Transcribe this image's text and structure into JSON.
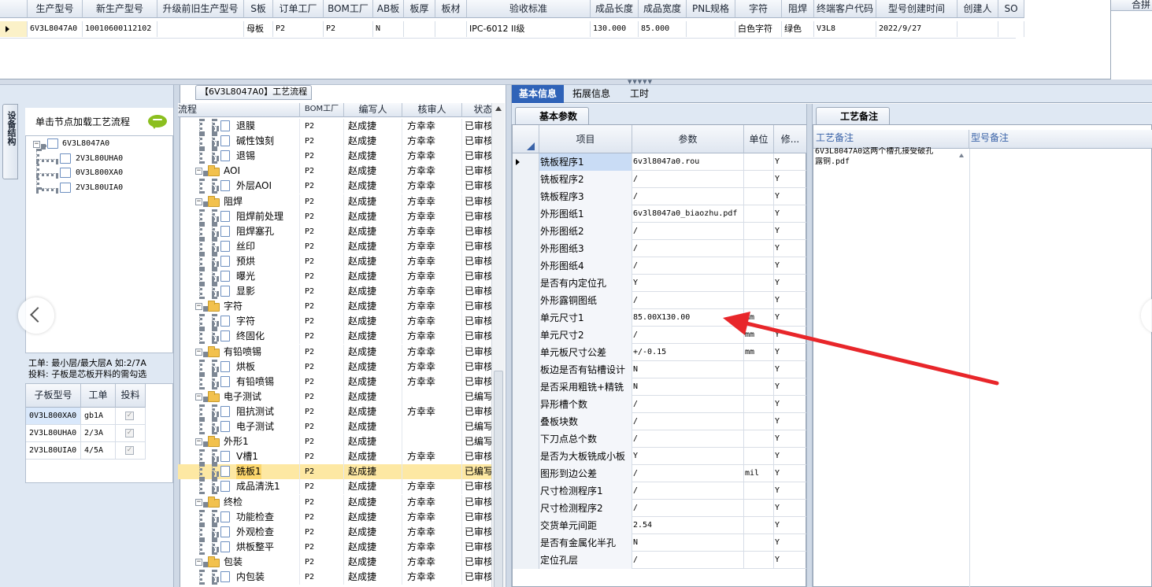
{
  "top_grid": {
    "columns": [
      "生产型号",
      "新生产型号",
      "升级前旧生产型号",
      "S板",
      "订单工厂",
      "BOM工厂",
      "AB板",
      "板厚",
      "板材",
      "验收标准",
      "成品长度",
      "成品宽度",
      "PNL规格",
      "字符",
      "阻焊",
      "终端客户代码",
      "型号创建时间",
      "创建人",
      "SO"
    ],
    "row": [
      "6V3L8047A0",
      "10010600112102",
      "",
      "母板",
      "P2",
      "P2",
      "N",
      "",
      "",
      "IPC-6012 II级",
      "130.000",
      "85.000",
      "",
      "白色字符",
      "绿色",
      "V3L8",
      "2022/9/27",
      "",
      ""
    ],
    "right_header": "合拼"
  },
  "left_panel": {
    "vertical_tab": "设备结构",
    "title": "单击节点加载工艺流程",
    "tree": {
      "root": "6V3L8047A0",
      "children": [
        "2V3L80UHA0",
        "0V3L800XA0",
        "2V3L80UIA0"
      ]
    },
    "note_line1": "工单: 最小层/最大层A 如:2/7A",
    "note_line2": "投料: 子板是芯板开料的需勾选",
    "sub_table": {
      "columns": [
        "子板型号",
        "工单",
        "投料"
      ],
      "rows": [
        [
          "0V3L800XA0",
          "gb1A",
          "✓"
        ],
        [
          "2V3L80UHA0",
          "2/3A",
          "✓"
        ],
        [
          "2V3L80UIA0",
          "4/5A",
          "✓"
        ]
      ]
    }
  },
  "process_panel": {
    "title": "【6V3L8047A0】工艺流程",
    "columns": [
      "流程",
      "BOM工厂",
      "编写人",
      "核审人",
      "状态"
    ],
    "rows": [
      {
        "name": "退膜",
        "type": "doc",
        "bom": "P2",
        "writer": "赵成捷",
        "reviewer": "方幸幸",
        "status": "已审核"
      },
      {
        "name": "碱性蚀刻",
        "type": "doc",
        "bom": "P2",
        "writer": "赵成捷",
        "reviewer": "方幸幸",
        "status": "已审核"
      },
      {
        "name": "退锡",
        "type": "doc",
        "bom": "P2",
        "writer": "赵成捷",
        "reviewer": "方幸幸",
        "status": "已审核"
      },
      {
        "name": "AOI",
        "type": "folder",
        "bom": "P2",
        "writer": "赵成捷",
        "reviewer": "方幸幸",
        "status": "已审核"
      },
      {
        "name": "外层AOI",
        "type": "doc",
        "bom": "P2",
        "writer": "赵成捷",
        "reviewer": "方幸幸",
        "status": "已审核"
      },
      {
        "name": "阻焊",
        "type": "folder",
        "bom": "P2",
        "writer": "赵成捷",
        "reviewer": "方幸幸",
        "status": "已审核"
      },
      {
        "name": "阻焊前处理",
        "type": "doc",
        "bom": "P2",
        "writer": "赵成捷",
        "reviewer": "方幸幸",
        "status": "已审核"
      },
      {
        "name": "阻焊塞孔",
        "type": "doc",
        "bom": "P2",
        "writer": "赵成捷",
        "reviewer": "方幸幸",
        "status": "已审核"
      },
      {
        "name": "丝印",
        "type": "doc",
        "bom": "P2",
        "writer": "赵成捷",
        "reviewer": "方幸幸",
        "status": "已审核"
      },
      {
        "name": "预烘",
        "type": "doc",
        "bom": "P2",
        "writer": "赵成捷",
        "reviewer": "方幸幸",
        "status": "已审核"
      },
      {
        "name": "曝光",
        "type": "doc",
        "bom": "P2",
        "writer": "赵成捷",
        "reviewer": "方幸幸",
        "status": "已审核"
      },
      {
        "name": "显影",
        "type": "doc",
        "bom": "P2",
        "writer": "赵成捷",
        "reviewer": "方幸幸",
        "status": "已审核"
      },
      {
        "name": "字符",
        "type": "folder",
        "bom": "P2",
        "writer": "赵成捷",
        "reviewer": "方幸幸",
        "status": "已审核"
      },
      {
        "name": "字符",
        "type": "doc",
        "bom": "P2",
        "writer": "赵成捷",
        "reviewer": "方幸幸",
        "status": "已审核"
      },
      {
        "name": "终固化",
        "type": "doc",
        "bom": "P2",
        "writer": "赵成捷",
        "reviewer": "方幸幸",
        "status": "已审核"
      },
      {
        "name": "有铅喷锡",
        "type": "folder",
        "bom": "P2",
        "writer": "赵成捷",
        "reviewer": "方幸幸",
        "status": "已审核"
      },
      {
        "name": "烘板",
        "type": "doc",
        "bom": "P2",
        "writer": "赵成捷",
        "reviewer": "方幸幸",
        "status": "已审核"
      },
      {
        "name": "有铅喷锡",
        "type": "doc",
        "bom": "P2",
        "writer": "赵成捷",
        "reviewer": "方幸幸",
        "status": "已审核"
      },
      {
        "name": "电子测试",
        "type": "folder",
        "bom": "P2",
        "writer": "赵成捷",
        "reviewer": "",
        "status": "已编写"
      },
      {
        "name": "阻抗测试",
        "type": "doc",
        "bom": "P2",
        "writer": "赵成捷",
        "reviewer": "方幸幸",
        "status": "已审核"
      },
      {
        "name": "电子测试",
        "type": "doc",
        "bom": "P2",
        "writer": "赵成捷",
        "reviewer": "",
        "status": "已编写"
      },
      {
        "name": "外形1",
        "type": "folder",
        "bom": "P2",
        "writer": "赵成捷",
        "reviewer": "",
        "status": "已编写"
      },
      {
        "name": "V槽1",
        "type": "doc",
        "bom": "P2",
        "writer": "赵成捷",
        "reviewer": "方幸幸",
        "status": "已审核"
      },
      {
        "name": "铣板1",
        "type": "doc",
        "bom": "P2",
        "writer": "赵成捷",
        "reviewer": "",
        "status": "已编写"
      },
      {
        "name": "成品清洗1",
        "type": "doc",
        "bom": "P2",
        "writer": "赵成捷",
        "reviewer": "方幸幸",
        "status": "已审核"
      },
      {
        "name": "终检",
        "type": "folder",
        "bom": "P2",
        "writer": "赵成捷",
        "reviewer": "方幸幸",
        "status": "已审核"
      },
      {
        "name": "功能检查",
        "type": "doc",
        "bom": "P2",
        "writer": "赵成捷",
        "reviewer": "方幸幸",
        "status": "已审核"
      },
      {
        "name": "外观检查",
        "type": "doc",
        "bom": "P2",
        "writer": "赵成捷",
        "reviewer": "方幸幸",
        "status": "已审核"
      },
      {
        "name": "烘板整平",
        "type": "doc",
        "bom": "P2",
        "writer": "赵成捷",
        "reviewer": "方幸幸",
        "status": "已审核"
      },
      {
        "name": "包装",
        "type": "folder",
        "bom": "P2",
        "writer": "赵成捷",
        "reviewer": "方幸幸",
        "status": "已审核"
      },
      {
        "name": "内包装",
        "type": "doc",
        "bom": "P2",
        "writer": "赵成捷",
        "reviewer": "方幸幸",
        "status": "已审核"
      }
    ]
  },
  "detail_panel": {
    "tabs": [
      "基本信息",
      "拓展信息",
      "工时"
    ],
    "sub_tab": "基本参数",
    "columns": [
      "项目",
      "参数",
      "单位",
      "修..."
    ],
    "rows": [
      {
        "item": "铣板程序1",
        "param": "6v3l8047a0.rou",
        "unit": "",
        "mod": "Y"
      },
      {
        "item": "铣板程序2",
        "param": "/",
        "unit": "",
        "mod": "Y"
      },
      {
        "item": "铣板程序3",
        "param": "/",
        "unit": "",
        "mod": "Y"
      },
      {
        "item": "外形图纸1",
        "param": "6v3l8047a0_biaozhu.pdf",
        "unit": "",
        "mod": "Y"
      },
      {
        "item": "外形图纸2",
        "param": "/",
        "unit": "",
        "mod": "Y"
      },
      {
        "item": "外形图纸3",
        "param": "/",
        "unit": "",
        "mod": "Y"
      },
      {
        "item": "外形图纸4",
        "param": "/",
        "unit": "",
        "mod": "Y"
      },
      {
        "item": "是否有内定位孔",
        "param": "Y",
        "unit": "",
        "mod": "Y"
      },
      {
        "item": "外形露铜图纸",
        "param": "/",
        "unit": "",
        "mod": "Y"
      },
      {
        "item": "单元尺寸1",
        "param": "85.00X130.00",
        "unit": "mm",
        "mod": "Y"
      },
      {
        "item": "单元尺寸2",
        "param": "/",
        "unit": "mm",
        "mod": "Y"
      },
      {
        "item": "单元板尺寸公差",
        "param": "+/-0.15",
        "unit": "mm",
        "mod": "Y"
      },
      {
        "item": "板边是否有钻槽设计",
        "param": "N",
        "unit": "",
        "mod": "Y"
      },
      {
        "item": "是否采用粗铣+精铣",
        "param": "N",
        "unit": "",
        "mod": "Y"
      },
      {
        "item": "异形槽个数",
        "param": "/",
        "unit": "",
        "mod": "Y"
      },
      {
        "item": "叠板块数",
        "param": "/",
        "unit": "",
        "mod": "Y"
      },
      {
        "item": "下刀点总个数",
        "param": "/",
        "unit": "",
        "mod": "Y"
      },
      {
        "item": "是否为大板铣成小板",
        "param": "Y",
        "unit": "",
        "mod": "Y"
      },
      {
        "item": "图形到边公差",
        "param": "/",
        "unit": "mil",
        "mod": "Y"
      },
      {
        "item": "尺寸检测程序1",
        "param": "/",
        "unit": "",
        "mod": "Y"
      },
      {
        "item": "尺寸检测程序2",
        "param": "/",
        "unit": "",
        "mod": "Y"
      },
      {
        "item": "交货单元间距",
        "param": "2.54",
        "unit": "",
        "mod": "Y"
      },
      {
        "item": "是否有金属化半孔",
        "param": "N",
        "unit": "",
        "mod": "Y"
      },
      {
        "item": "定位孔层",
        "param": "/",
        "unit": "",
        "mod": "Y"
      }
    ]
  },
  "notes_panel": {
    "tab": "工艺备注",
    "columns": [
      "工艺备注",
      "型号备注"
    ],
    "note_text_line1": "6V3L8047A0这两个槽孔接受破孔",
    "note_text_line2": "露铜.pdf"
  },
  "colors": {
    "arrow": "#e8262a",
    "active_tab": "#2f63b8",
    "selected_row": "#fde8a3",
    "left_bg": "#dfe8f3"
  },
  "icons": [
    "chevron-left-icon",
    "speech-bubble-icon",
    "red-arrow-icon"
  ]
}
